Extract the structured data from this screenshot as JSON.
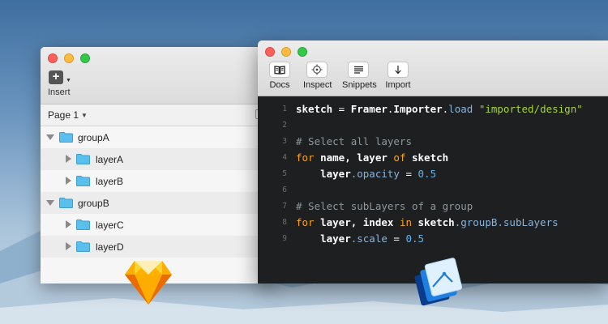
{
  "sketch_window": {
    "toolbar": {
      "insert_label": "Insert",
      "insert_symbol": "+"
    },
    "page_selector": {
      "label": "Page 1"
    },
    "layers": [
      {
        "name": "groupA",
        "level": 0,
        "expanded": true
      },
      {
        "name": "layerA",
        "level": 1,
        "expanded": false
      },
      {
        "name": "layerB",
        "level": 1,
        "expanded": false
      },
      {
        "name": "groupB",
        "level": 0,
        "expanded": true
      },
      {
        "name": "layerC",
        "level": 1,
        "expanded": false
      },
      {
        "name": "layerD",
        "level": 1,
        "expanded": false
      }
    ]
  },
  "framer_window": {
    "toolbar": {
      "docs_label": "Docs",
      "inspect_label": "Inspect",
      "snippets_label": "Snippets",
      "import_label": "Import"
    },
    "code": {
      "line_numbers": [
        "1",
        "2",
        "3",
        "4",
        "5",
        "6",
        "7",
        "8",
        "9"
      ],
      "l1": {
        "a": "sketch",
        "b": " = ",
        "c": "Framer",
        "d": ".",
        "e": "Importer",
        "f": ".",
        "g": "load",
        "h": " ",
        "i": "\"imported/design\""
      },
      "l3": {
        "a": "# Select all layers"
      },
      "l4": {
        "a": "for",
        "b": " name, layer ",
        "c": "of",
        "d": " sketch"
      },
      "l5": {
        "a": "    layer",
        "b": ".opacity",
        "c": " = ",
        "d": "0.5"
      },
      "l7": {
        "a": "# Select subLayers of a group"
      },
      "l8": {
        "a": "for",
        "b": " layer, index ",
        "c": "in",
        "d": " sketch",
        "e": ".groupB",
        "f": ".subLayers"
      },
      "l9": {
        "a": "    layer",
        "b": ".scale",
        "c": " = ",
        "d": "0.5"
      }
    }
  },
  "colors": {
    "keyword": "#f6a623",
    "string": "#a8d52d",
    "number": "#5fb3e8",
    "property": "#8ab4d8",
    "comment": "#8e979c",
    "editor_bg": "#1d1f21",
    "folder": "#5bbfee"
  },
  "icons": {
    "sketch_app": "sketch-diamond-icon",
    "framer_app": "framer-app-icon",
    "docs": "book-icon",
    "inspect": "crosshair-icon",
    "snippets": "lines-icon",
    "import": "arrow-down-icon"
  }
}
